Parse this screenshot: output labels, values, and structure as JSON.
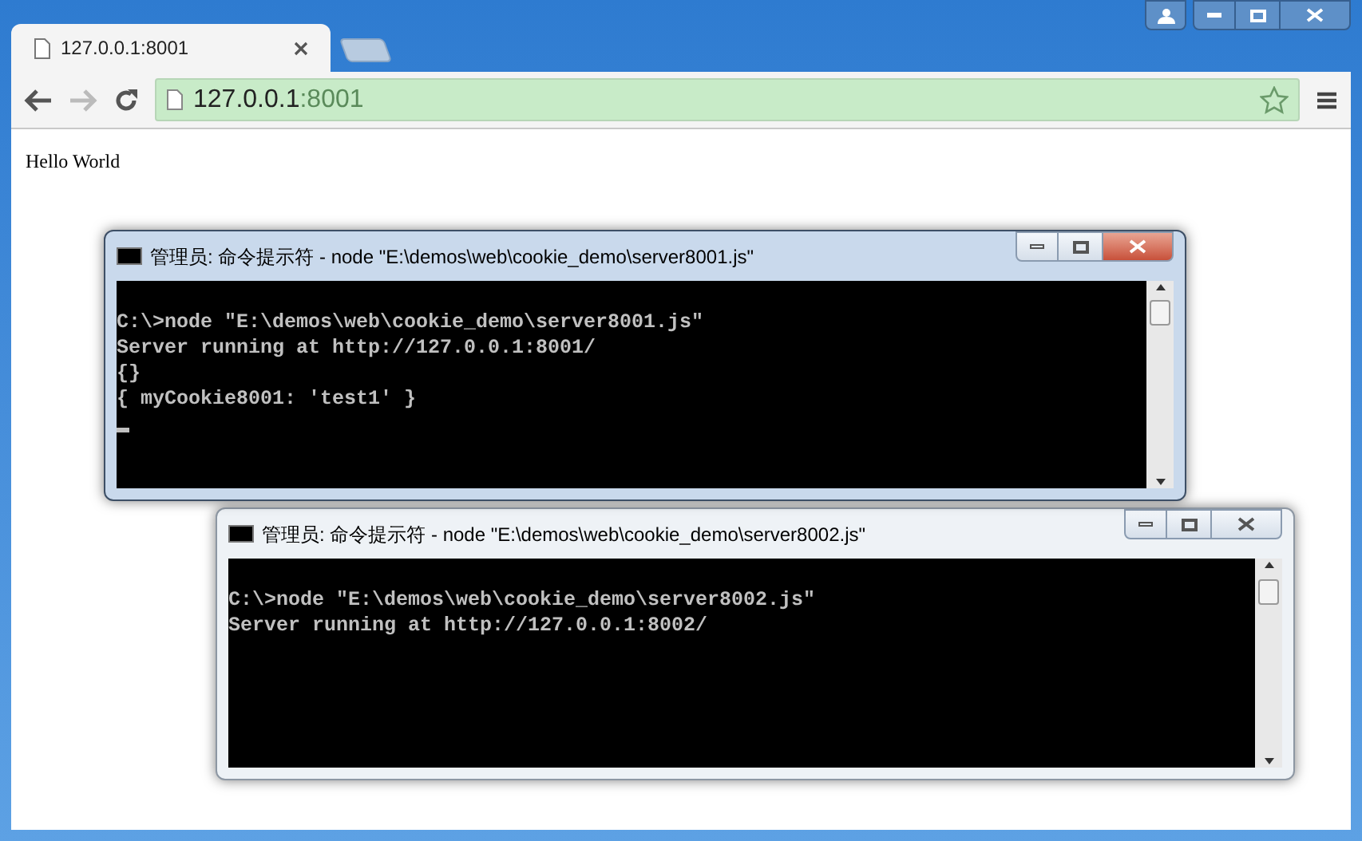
{
  "browser": {
    "tabs": [
      {
        "title": "127.0.0.1:8001",
        "selected": true
      }
    ],
    "address": {
      "host": "127.0.0.1",
      "port": ":8001"
    },
    "page_text": "Hello World"
  },
  "consoles": [
    {
      "title": "管理员: 命令提示符 - node  \"E:\\demos\\web\\cookie_demo\\server8001.js\"",
      "active": true,
      "cursor": true,
      "lines": [
        "C:\\>node \"E:\\demos\\web\\cookie_demo\\server8001.js\"",
        "Server running at http://127.0.0.1:8001/",
        "{}",
        "{ myCookie8001: 'test1' }"
      ]
    },
    {
      "title": "管理员: 命令提示符 - node  \"E:\\demos\\web\\cookie_demo\\server8002.js\"",
      "active": false,
      "cursor": false,
      "lines": [
        "C:\\>node \"E:\\demos\\web\\cookie_demo\\server8002.js\"",
        "Server running at http://127.0.0.1:8002/"
      ]
    }
  ]
}
